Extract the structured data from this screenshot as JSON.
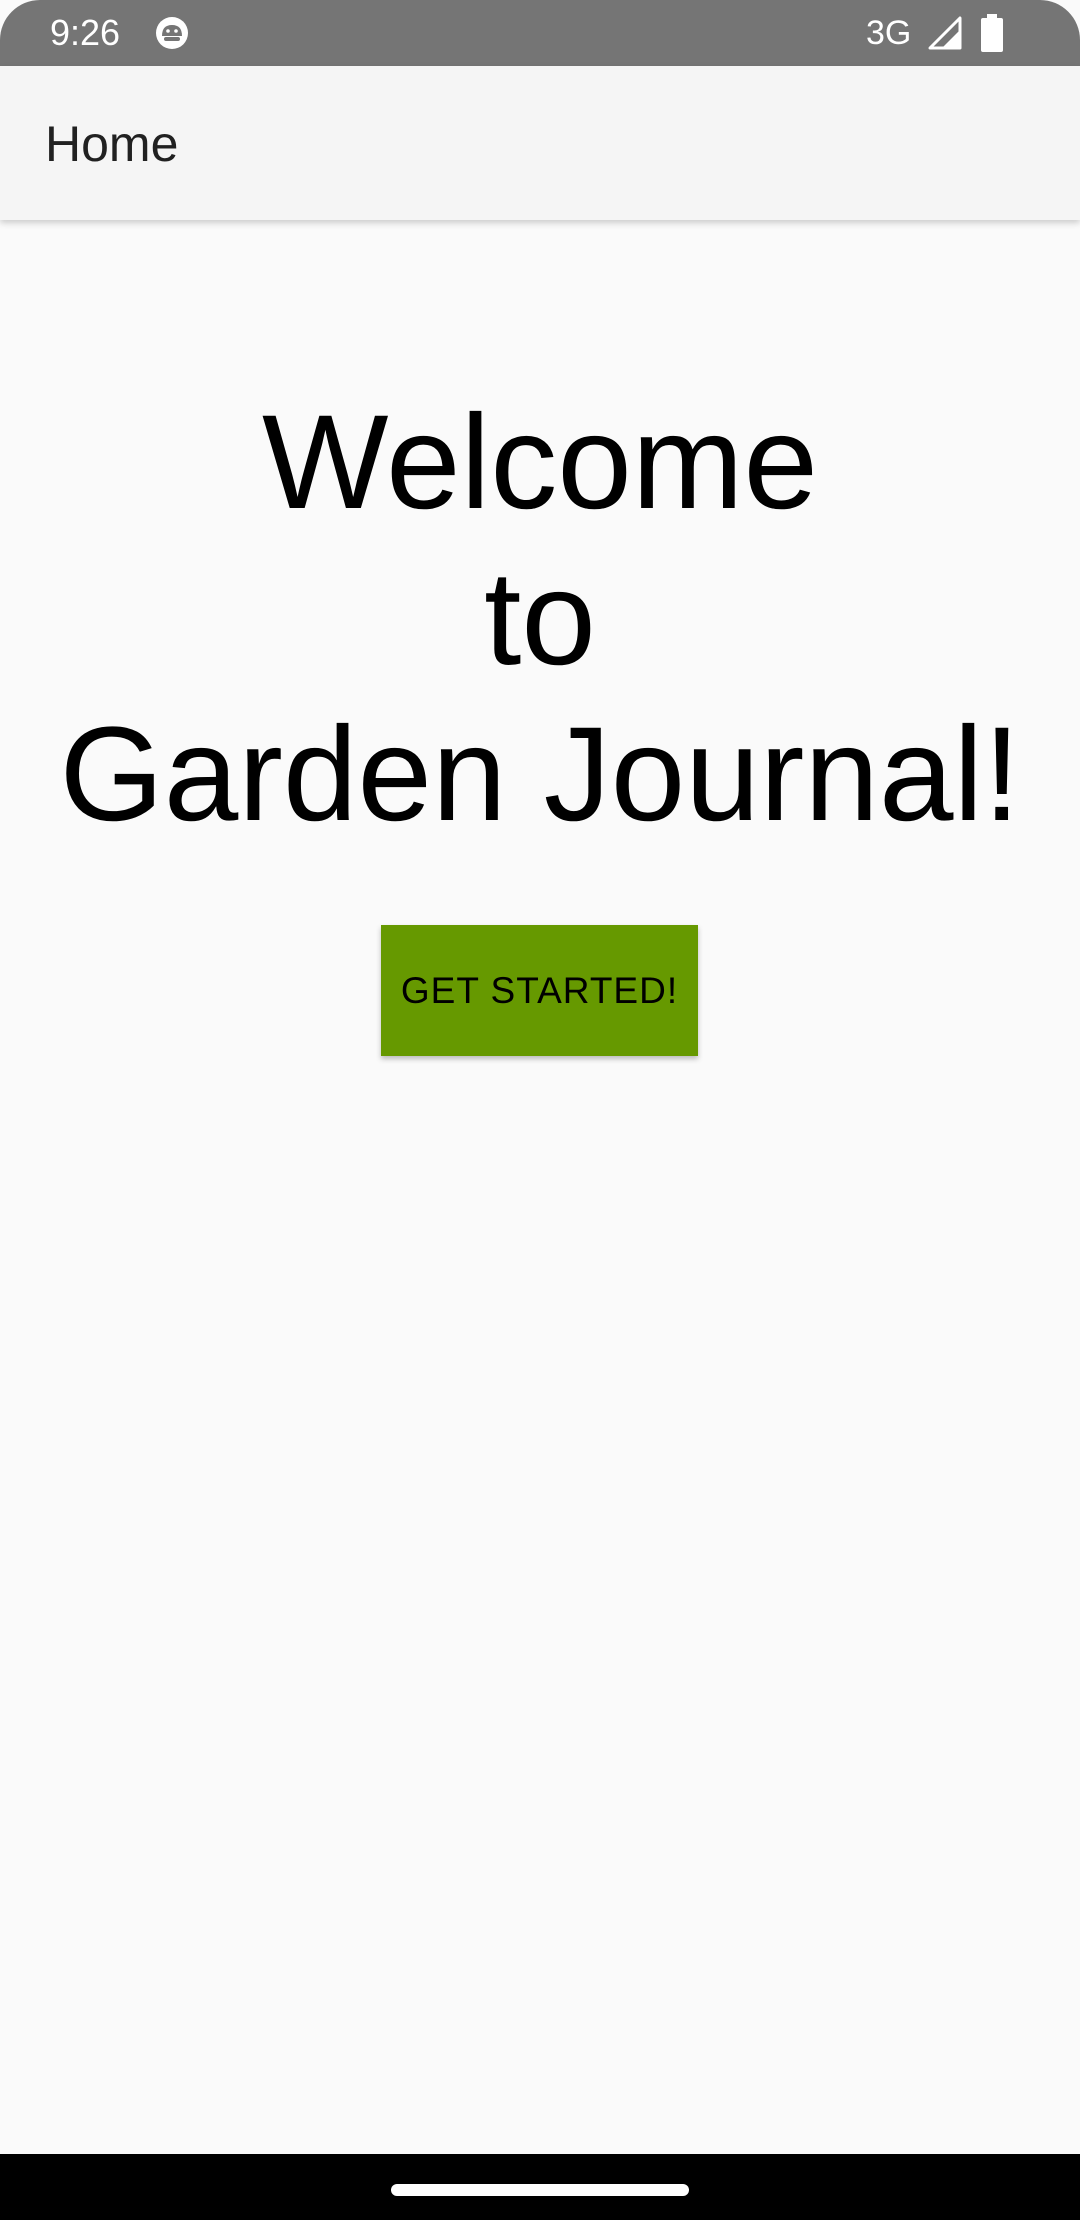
{
  "status_bar": {
    "time": "9:26",
    "network": "3G",
    "notification_icon": "android-debug-icon",
    "signal_icon": "cell-signal-icon",
    "battery_icon": "battery-icon",
    "background": "#757575"
  },
  "app_bar": {
    "title": "Home",
    "background": "#f5f5f5"
  },
  "main": {
    "welcome_lines": [
      "Welcome",
      "to",
      "Garden Journal!"
    ],
    "button_label": "GET STARTED!",
    "button_color": "#669900"
  },
  "nav_bar": {
    "background": "#000000"
  }
}
